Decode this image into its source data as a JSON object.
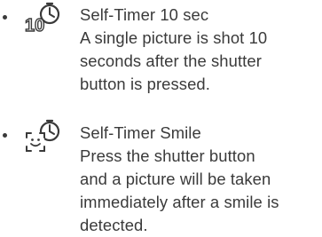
{
  "items": [
    {
      "icon": "self-timer-10-sec-icon",
      "icon_label": "10",
      "lines": [
        "Self-Timer 10 sec",
        "A single picture is shot 10",
        "seconds after the shutter",
        "button is pressed."
      ]
    },
    {
      "icon": "self-timer-smile-icon",
      "lines": [
        "Self-Timer Smile",
        "Press the shutter button",
        "and a picture will be taken",
        "immediately after a smile is",
        "detected."
      ]
    }
  ]
}
